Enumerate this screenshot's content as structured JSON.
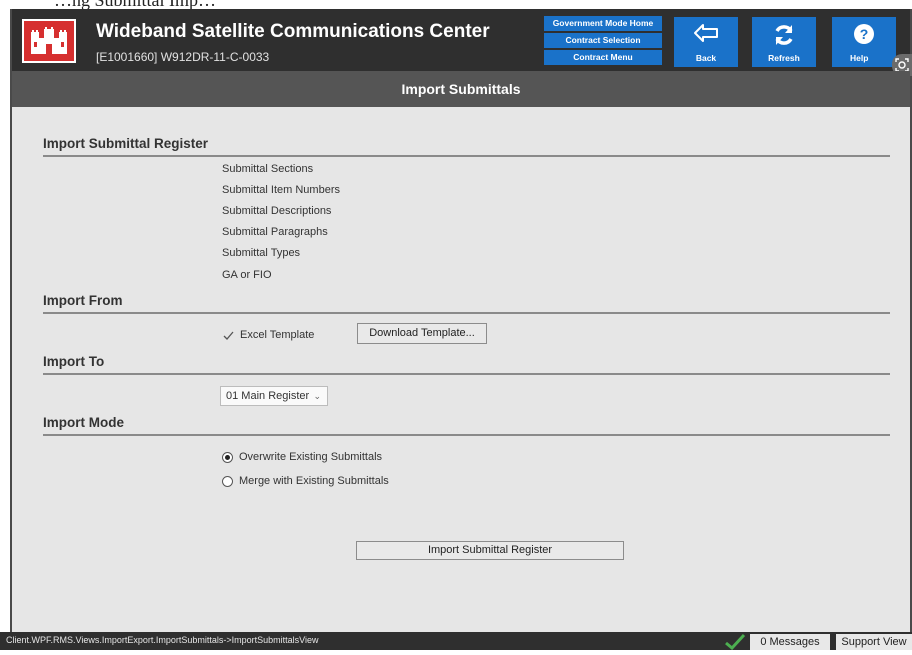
{
  "top_cut_text": "…ng Submittal Imp…",
  "header": {
    "app_title": "Wideband Satellite Communications Center",
    "contract_id": "[E1001660] W912DR-11-C-0033",
    "nav_links": [
      "Government Mode Home",
      "Contract Selection",
      "Contract Menu"
    ],
    "back_label": "Back",
    "refresh_label": "Refresh",
    "help_label": "Help"
  },
  "page_title": "Import Submittals",
  "sections": {
    "register": {
      "heading": "Import Submittal Register",
      "items": [
        "Submittal Sections",
        "Submittal Item Numbers",
        "Submittal Descriptions",
        "Submittal Paragraphs",
        "Submittal Types",
        "GA or FIO"
      ]
    },
    "import_from": {
      "heading": "Import From",
      "excel_template_label": "Excel Template",
      "excel_template_checked": true,
      "download_button": "Download Template..."
    },
    "import_to": {
      "heading": "Import To",
      "selected_register": "01 Main Register"
    },
    "import_mode": {
      "heading": "Import Mode",
      "options": [
        "Overwrite Existing Submittals",
        "Merge with Existing Submittals"
      ],
      "selected": "Overwrite Existing Submittals"
    }
  },
  "import_button": "Import Submittal Register",
  "statusbar": {
    "path": "Client.WPF.RMS.Views.ImportExport.ImportSubmittals->ImportSubmittalsView",
    "messages": "0 Messages",
    "support_view": "Support View"
  },
  "colors": {
    "header_bg": "#2f2f2f",
    "title_bar_bg": "#555555",
    "tile_blue": "#1a72c9",
    "logo_red": "#d62f2f",
    "content_bg": "#e6e6e6",
    "status_check": "#4caf50"
  }
}
